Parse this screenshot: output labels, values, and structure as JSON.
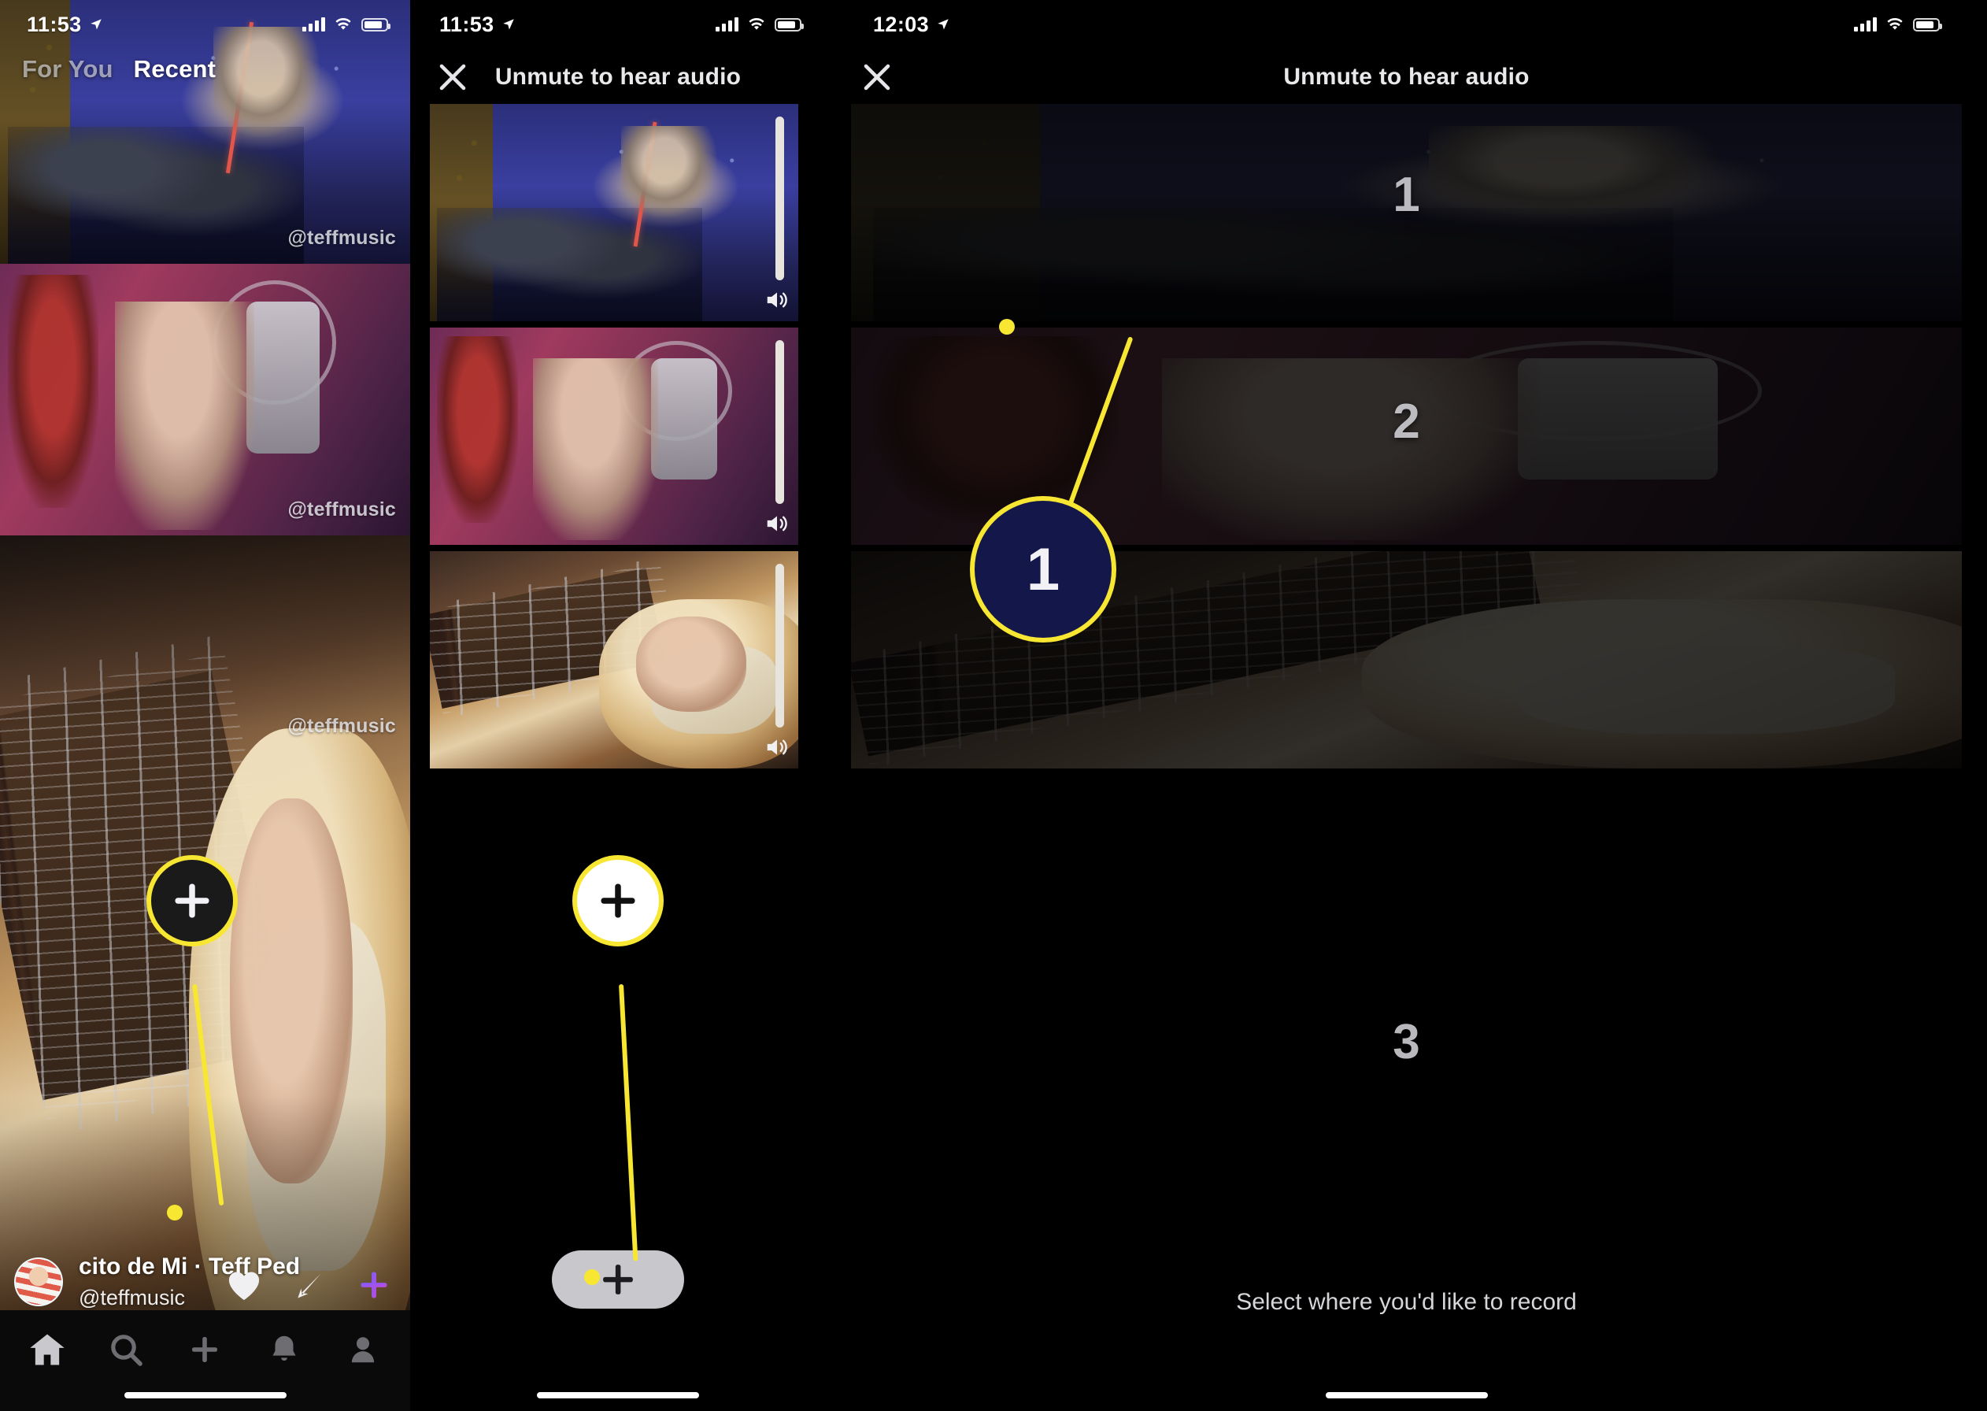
{
  "panels": [
    {
      "id": "feed",
      "status_bar": {
        "time": "11:53",
        "location_icon": "location-arrow-icon",
        "signal_icon": "cellular-signal-icon",
        "wifi_icon": "wifi-icon",
        "battery_icon": "battery-icon"
      },
      "tabs": [
        {
          "label": "For You",
          "active": false
        },
        {
          "label": "Recent",
          "active": true
        }
      ],
      "watermarks": [
        "@teffmusic",
        "@teffmusic",
        "@teffmusic"
      ],
      "now_playing": {
        "song_line": "cito de Mi  ·  Teff Ped",
        "handle": "@teffmusic",
        "avatar_name": "user-avatar"
      },
      "actions": [
        {
          "name": "like-button",
          "icon": "heart-icon"
        },
        {
          "name": "share-button",
          "icon": "share-arrow-icon"
        },
        {
          "name": "add-button",
          "icon": "plus-icon"
        }
      ],
      "tabbar": [
        {
          "name": "tab-home",
          "icon": "home-icon",
          "active": true
        },
        {
          "name": "tab-search",
          "icon": "search-icon",
          "active": false
        },
        {
          "name": "tab-create",
          "icon": "plus-icon",
          "active": false
        },
        {
          "name": "tab-notifications",
          "icon": "bell-icon",
          "active": false
        },
        {
          "name": "tab-profile",
          "icon": "person-icon",
          "active": false
        }
      ],
      "callout": {
        "number": "",
        "glyph": "+",
        "style": "dark"
      }
    },
    {
      "id": "collab-picker",
      "status_bar": {
        "time": "11:53",
        "location_icon": "location-arrow-icon",
        "signal_icon": "cellular-signal-icon",
        "wifi_icon": "wifi-icon",
        "battery_icon": "battery-icon"
      },
      "header": {
        "close_icon": "close-icon",
        "title": "Unmute to hear audio"
      },
      "clips": [
        {
          "name": "clip-drums",
          "volume_icon": "speaker-icon",
          "slider": "volume-slider"
        },
        {
          "name": "clip-vocals",
          "volume_icon": "speaker-icon",
          "slider": "volume-slider"
        },
        {
          "name": "clip-guitar",
          "volume_icon": "speaker-icon",
          "slider": "volume-slider"
        }
      ],
      "add_pill": {
        "name": "add-track-button",
        "glyph": "+"
      },
      "callout": {
        "glyph": "+",
        "style": "light"
      }
    },
    {
      "id": "select-slot",
      "status_bar": {
        "time": "12:03",
        "location_icon": "location-arrow-icon",
        "signal_icon": "cellular-signal-icon",
        "wifi_icon": "wifi-icon",
        "battery_icon": "battery-icon"
      },
      "header": {
        "close_icon": "close-icon",
        "title": "Unmute to hear audio"
      },
      "slots": [
        {
          "number": "1",
          "name": "slot-1"
        },
        {
          "number": "2",
          "name": "slot-2"
        },
        {
          "number": "3",
          "name": "slot-3"
        }
      ],
      "instruction": "Select where you'd like to record",
      "callout": {
        "number": "1",
        "style": "dark-navy"
      }
    }
  ],
  "colors": {
    "callout_ring": "#f7e733",
    "callout_dark_fill": "#1a1a1a",
    "callout_light_fill": "#ffffff",
    "callout_navy_fill": "#14174a",
    "pill_fill": "#c7c7cc",
    "active_tab_text": "#ffffff",
    "inactive_tab_text": "#a0a0ab"
  }
}
